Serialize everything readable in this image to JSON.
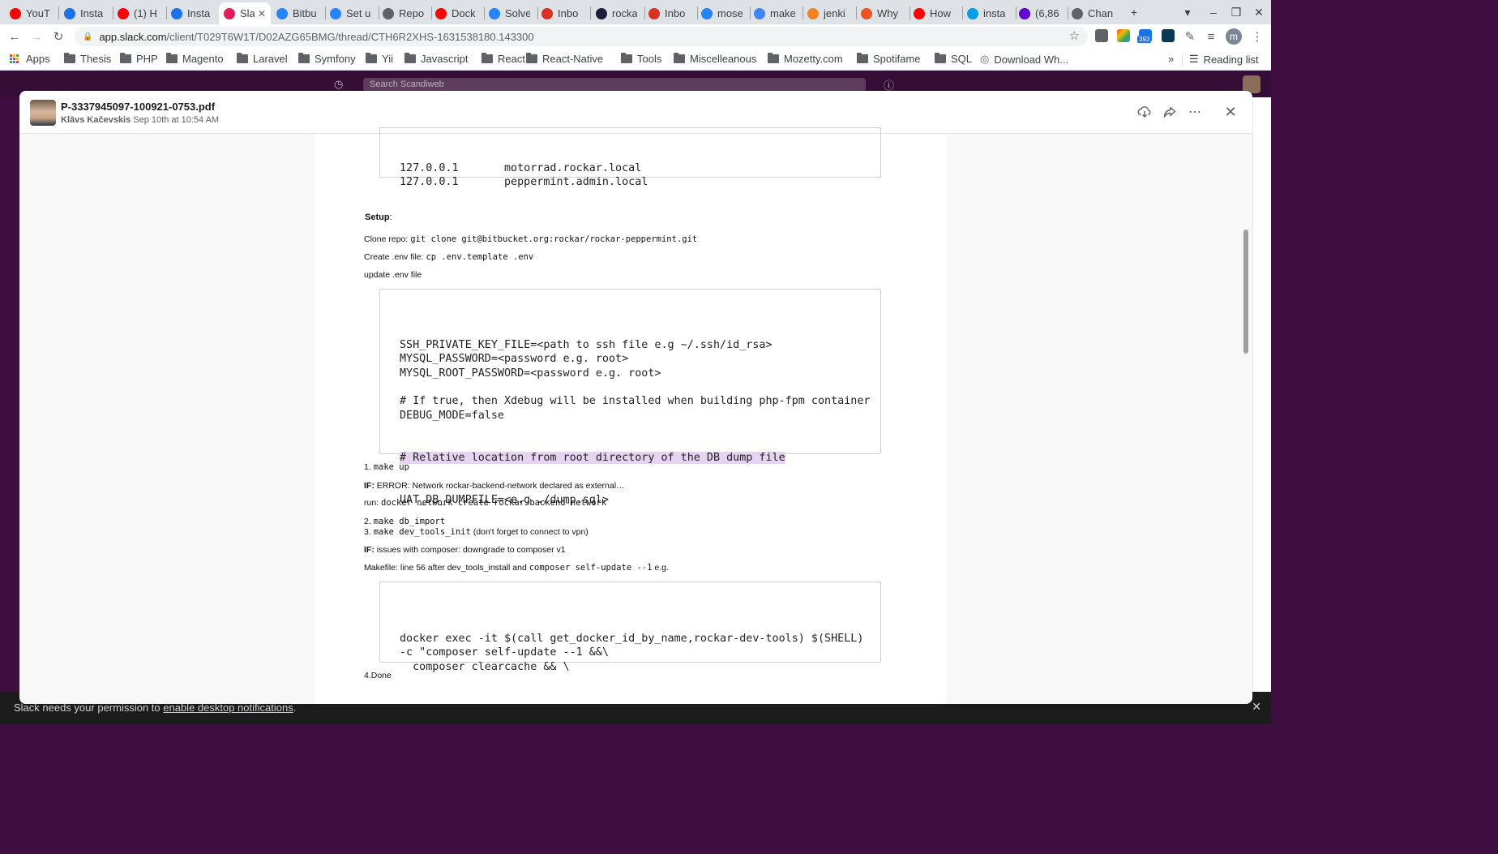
{
  "browser": {
    "tabs": [
      {
        "title": "YouT",
        "icon": "youtube-icon",
        "color": "#ff0000"
      },
      {
        "title": "Insta",
        "icon": "installer-icon",
        "color": "#1a73e8"
      },
      {
        "title": "(1) H",
        "icon": "youtube-icon",
        "color": "#ff0000"
      },
      {
        "title": "Insta",
        "icon": "installer-icon",
        "color": "#1a73e8"
      },
      {
        "title": "Sla",
        "icon": "slack-icon",
        "color": "#e01e5a"
      },
      {
        "title": "Bitbu",
        "icon": "bitbucket-icon",
        "color": "#2684ff"
      },
      {
        "title": "Set u",
        "icon": "atlassian-icon",
        "color": "#2684ff"
      },
      {
        "title": "Repo",
        "icon": "globe-icon",
        "color": "#5f6368"
      },
      {
        "title": "Dock",
        "icon": "youtube-icon",
        "color": "#ff0000"
      },
      {
        "title": "Solve",
        "icon": "atlassian-icon",
        "color": "#2684ff"
      },
      {
        "title": "Inbo",
        "icon": "gmail-icon",
        "color": "#d93025"
      },
      {
        "title": "rocka",
        "icon": "github-icon",
        "color": "#1b1f3b"
      },
      {
        "title": "Inbo",
        "icon": "gmail-icon",
        "color": "#d93025"
      },
      {
        "title": "mose",
        "icon": "bitbucket-icon",
        "color": "#2684ff"
      },
      {
        "title": "make",
        "icon": "google-icon",
        "color": "#4285f4"
      },
      {
        "title": "jenki",
        "icon": "stackoverflow-icon",
        "color": "#f48024"
      },
      {
        "title": "Why",
        "icon": "askubuntu-icon",
        "color": "#e95420"
      },
      {
        "title": "How",
        "icon": "youtube-icon",
        "color": "#ff0000"
      },
      {
        "title": "insta",
        "icon": "globe-icon",
        "color": "#00a0e9"
      },
      {
        "title": "(6,86",
        "icon": "mail-icon",
        "color": "#6001d2"
      },
      {
        "title": "Chan",
        "icon": "home-icon",
        "color": "#5f6368"
      }
    ],
    "url_host": "app.slack.com",
    "url_path": "/client/T029T6W1T/D02AZG65BMG/thread/CTH6R2XHS-1631538180.143300",
    "extension_badge": "393",
    "profile_initial": "m",
    "bookmarks": [
      "Apps",
      "Thesis",
      "PHP",
      "Magento",
      "Laravel",
      "Symfony",
      "Yii",
      "Javascript",
      "React",
      "React-Native",
      "Tools",
      "Miscelleanous",
      "Mozetty.com",
      "Spotifame",
      "SQL",
      "Download Wh..."
    ],
    "reading_list": "Reading list"
  },
  "slack": {
    "search_placeholder": "Search Scandiweb",
    "banner_text": "Slack needs your permission to ",
    "banner_link": "enable desktop notifications"
  },
  "modal": {
    "file_name": "P-3337945097-100921-0753.pdf",
    "author": "Klāvs Kačevskis",
    "timestamp": "Sep 10th at 10:54 AM"
  },
  "pdf": {
    "hosts_lines": "127.0.0.1       motorrad.rockar.local\n127.0.0.1       peppermint.admin.local",
    "setup_heading": "Setup",
    "setup_colon": ":",
    "clone_label": "Clone repo: ",
    "clone_cmd": "git clone git@bitbucket.org:rockar/rockar-peppermint.git",
    "env_label": "Create .env file: ",
    "env_cmd": "cp .env.template .env",
    "update_env": "update .env file",
    "env_block_1": "SSH_PRIVATE_KEY_FILE=<path to ssh file e.g ~/.ssh/id_rsa>\nMYSQL_PASSWORD=<password e.g. root>\nMYSQL_ROOT_PASSWORD=<password e.g. root>\n\n# If true, then Xdebug will be installed when building php-fpm container\nDEBUG_MODE=false\n",
    "env_block_hl": "# Relative location from root directory of the DB dump file",
    "env_block_2": "UAT_DB_DUMPFILE=<e.g ./dump.sql>",
    "step1_num": "1. ",
    "step1_cmd": "make up",
    "if1_label": "IF:",
    "if1_text": " ERROR: Network rockar-backend-network declared as external…",
    "run_label": "run: ",
    "run_cmd": "docker network create rockar-backend-network",
    "step2_num": "2. ",
    "step2_cmd": "make db_import",
    "step3_num": "3. ",
    "step3_cmd": "make dev_tools_init",
    "step3_note": " (don't forget to connect to vpn)",
    "if2_label": "IF:",
    "if2_text": " issues with composer: downgrade to composer v1",
    "makefile_text": "Makefile: line 56 after dev_tools_install and ",
    "makefile_cmd": "composer self-update --1",
    "makefile_eg": " e.g.",
    "docker_block": "docker exec -it $(call get_docker_id_by_name,rockar-dev-tools) $(SHELL)\n-c \"composer self-update --1 &&\\\n  composer clearcache && \\",
    "done": "4.Done"
  }
}
